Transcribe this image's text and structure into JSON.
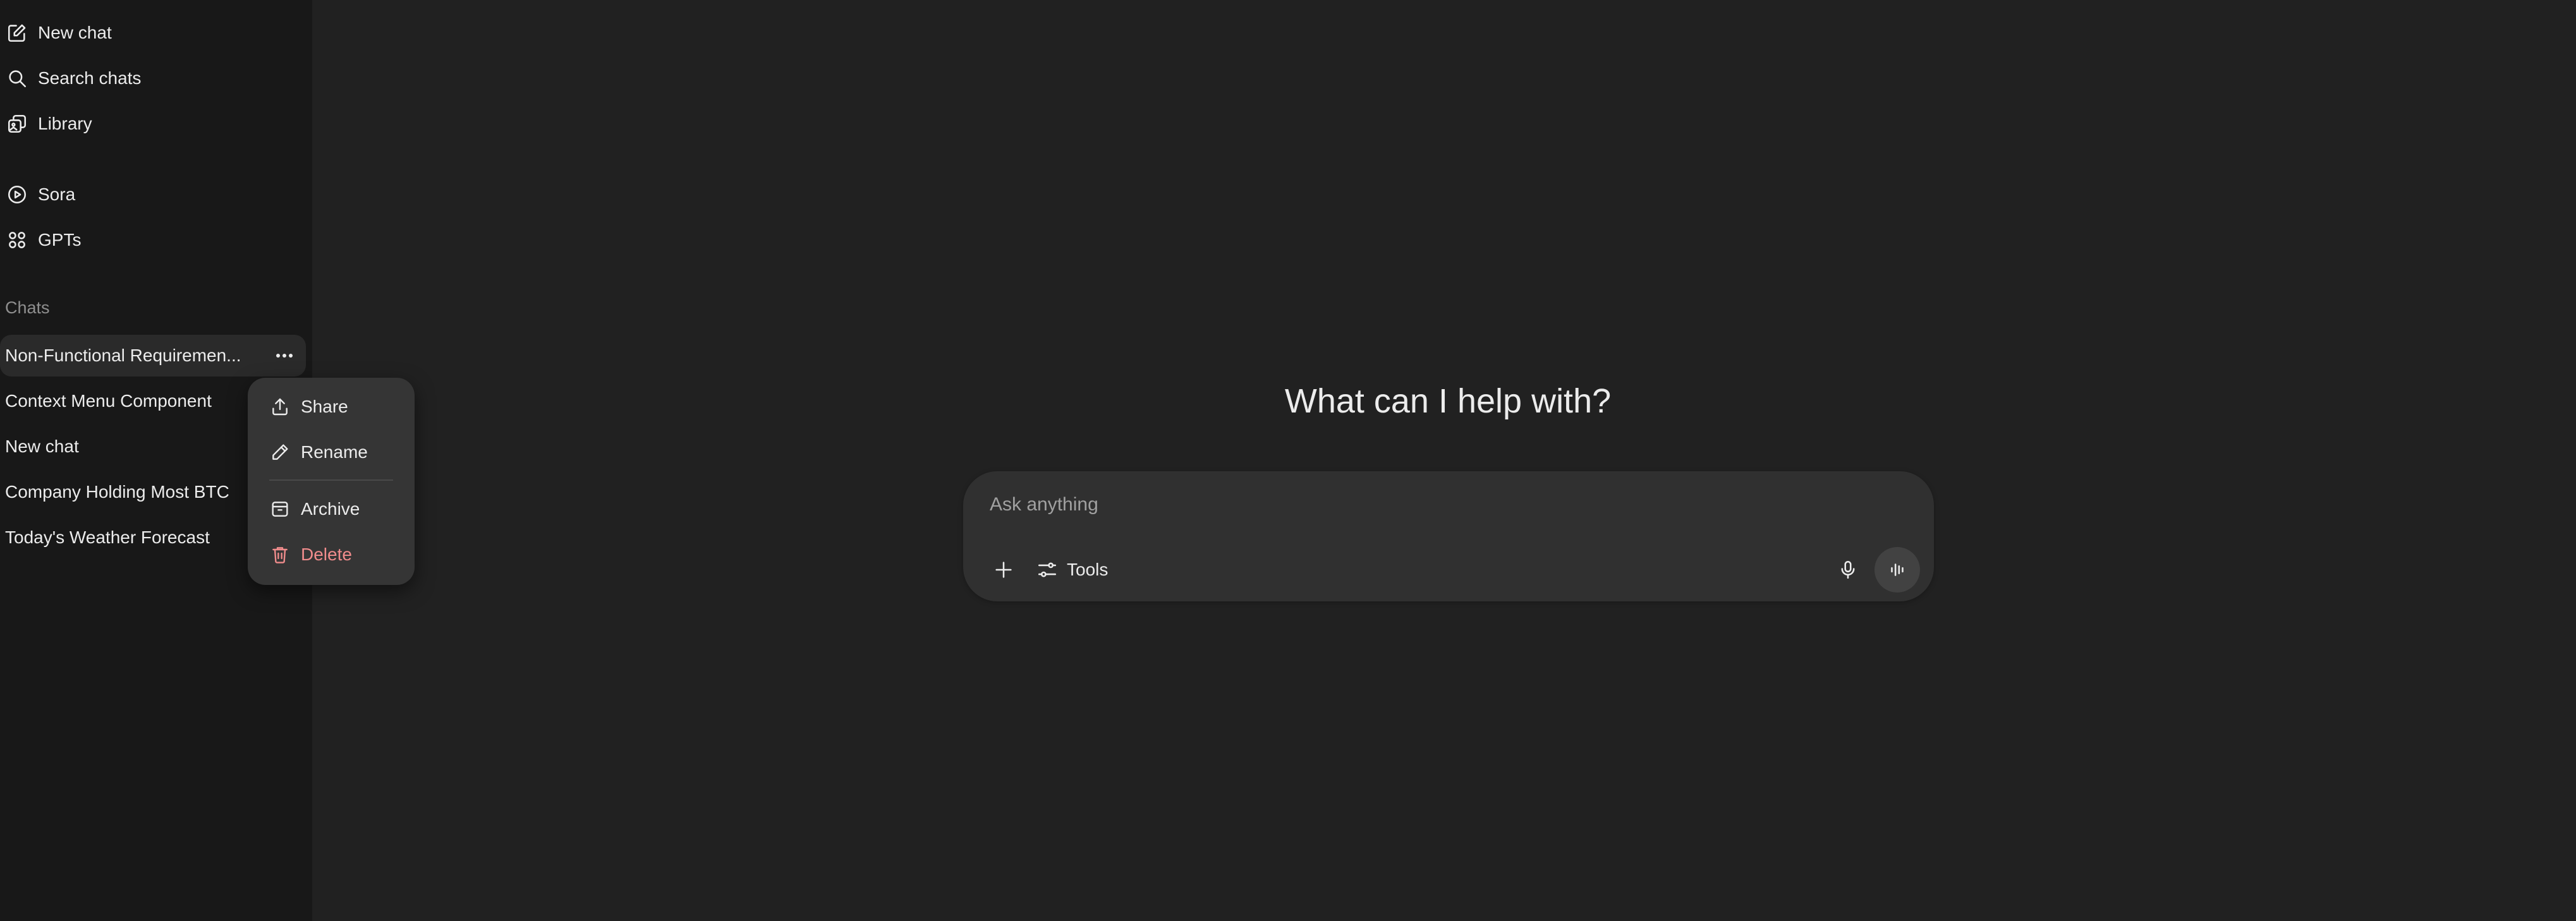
{
  "sidebar": {
    "nav": [
      {
        "label": "New chat",
        "icon": "edit-icon"
      },
      {
        "label": "Search chats",
        "icon": "search-icon"
      },
      {
        "label": "Library",
        "icon": "library-icon"
      },
      {
        "label": "Sora",
        "icon": "play-icon"
      },
      {
        "label": "GPTs",
        "icon": "grid-icon"
      }
    ],
    "section_label": "Chats",
    "chats": [
      {
        "label": "Non-Functional Requiremen..."
      },
      {
        "label": "Context Menu Component"
      },
      {
        "label": "New chat"
      },
      {
        "label": "Company Holding Most BTC"
      },
      {
        "label": "Today's Weather Forecast"
      }
    ]
  },
  "context_menu": {
    "items": [
      {
        "label": "Share",
        "icon": "share-icon"
      },
      {
        "label": "Rename",
        "icon": "pencil-icon"
      },
      {
        "label": "Archive",
        "icon": "archive-icon"
      },
      {
        "label": "Delete",
        "icon": "trash-icon"
      }
    ]
  },
  "main": {
    "headline": "What can I help with?",
    "composer": {
      "placeholder": "Ask anything",
      "tools_label": "Tools"
    }
  },
  "colors": {
    "background": "#212121",
    "sidebar": "#181818",
    "composer": "#303030",
    "menu": "#353535",
    "danger": "#f08c8c"
  }
}
